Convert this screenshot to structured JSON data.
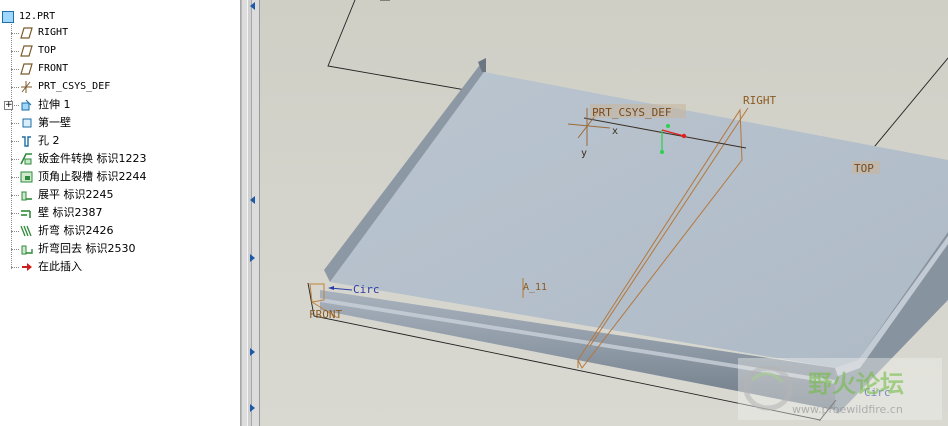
{
  "tree": {
    "root": {
      "label": "12.PRT"
    },
    "items": [
      {
        "label": "RIGHT",
        "icon": "datum-plane-icon"
      },
      {
        "label": "TOP",
        "icon": "datum-plane-icon"
      },
      {
        "label": "FRONT",
        "icon": "datum-plane-icon"
      },
      {
        "label": "PRT_CSYS_DEF",
        "icon": "coordinate-system-icon"
      },
      {
        "label": "拉伸 1",
        "icon": "extrude-icon"
      },
      {
        "label": "第一壁",
        "icon": "first-wall-icon"
      },
      {
        "label": "孔 2",
        "icon": "hole-icon"
      },
      {
        "label": "钣金件转换 标识1223",
        "icon": "sheetmetal-convert-icon"
      },
      {
        "label": "顶角止裂槽 标识2244",
        "icon": "corner-relief-icon"
      },
      {
        "label": "展平 标识2245",
        "icon": "unbend-icon"
      },
      {
        "label": "壁 标识2387",
        "icon": "wall-icon"
      },
      {
        "label": "折弯 标识2426",
        "icon": "bend-icon"
      },
      {
        "label": "折弯回去 标识2530",
        "icon": "bend-back-icon"
      },
      {
        "label": "在此插入",
        "icon": "insert-here-arrow-icon"
      }
    ]
  },
  "viewport": {
    "labels": {
      "csys": "PRT_CSYS_DEF",
      "x_axis": "x",
      "y_axis": "y",
      "right": "RIGHT",
      "top": "TOP",
      "front": "FRONT",
      "axis": "A_11",
      "circ_left": "Circ",
      "circ_right": "Circ"
    },
    "colors": {
      "background": "#d4d4cc",
      "sheet_face": "#b3bfcb",
      "sheet_edge": "#7d8896",
      "datum": "#c2823c"
    }
  },
  "watermark": {
    "title": "野火论坛",
    "url": "www.proewildfire.cn"
  }
}
